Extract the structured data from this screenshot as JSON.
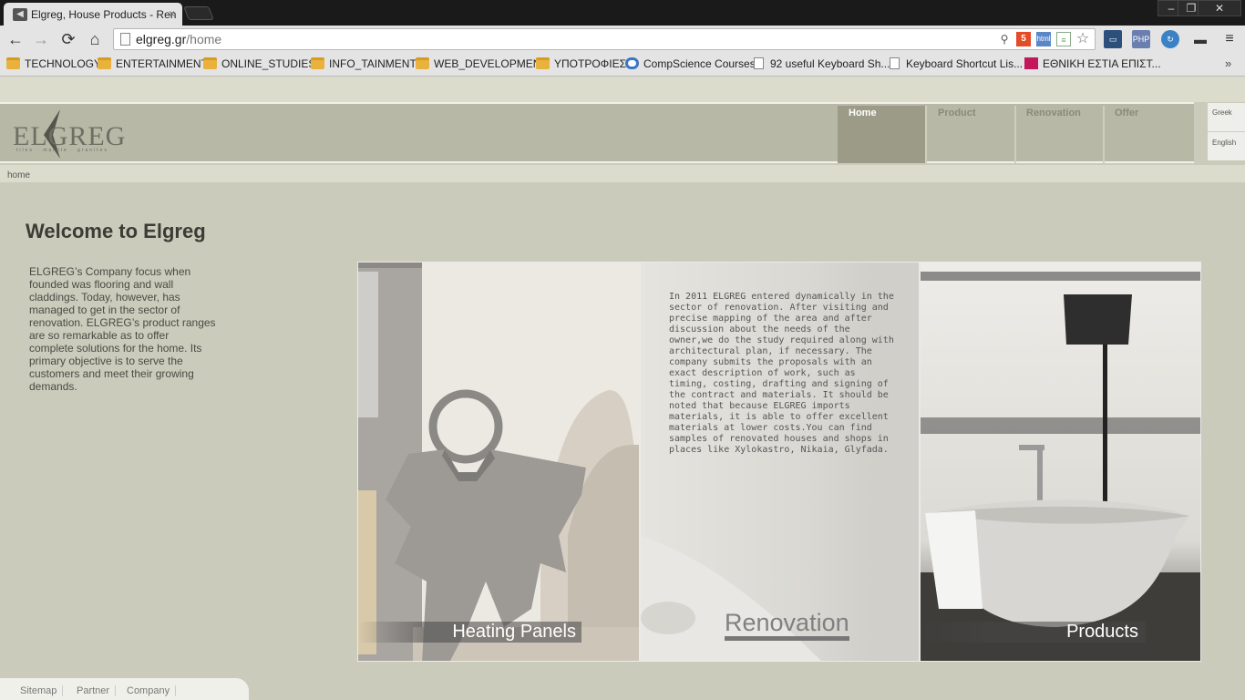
{
  "browser": {
    "tab_title": "Elgreg, House Products - Ren",
    "tab_close": "×",
    "window_controls": {
      "minimize": "–",
      "maximize": "❐",
      "close": "✕"
    },
    "nav": {
      "back": "←",
      "forward": "→",
      "reload": "⟳",
      "home": "⌂"
    },
    "url_host": "elgreg.gr",
    "url_path": "/home",
    "extensions": {
      "html5": "5",
      "ext2": "html",
      "ext3": "≡",
      "star": "☆",
      "screen": "▭",
      "php": "PHP",
      "sync": "↻",
      "bar": "▬",
      "menu": "≡"
    },
    "bookmarks": [
      {
        "label": "TECHNOLOGY",
        "icon": "folder-icon"
      },
      {
        "label": "ENTERTAINMENT",
        "icon": "folder-icon"
      },
      {
        "label": "ONLINE_STUDIES",
        "icon": "folder-icon"
      },
      {
        "label": "INFO_TAINMENT",
        "icon": "folder-icon"
      },
      {
        "label": "WEB_DEVELOPMENT",
        "icon": "folder-icon"
      },
      {
        "label": "ΥΠΟΤΡΟΦΙΕΣ",
        "icon": "folder-icon"
      },
      {
        "label": "CompScience Courses",
        "icon": "compscience-icon"
      },
      {
        "label": "92 useful Keyboard Sh...",
        "icon": "page-icon"
      },
      {
        "label": "Keyboard Shortcut Lis...",
        "icon": "page-icon"
      },
      {
        "label": "ΕΘΝΙΚΗ ΕΣΤΙΑ ΕΠΙΣΤ...",
        "icon": "site-icon"
      }
    ],
    "bookmarks_more": "»"
  },
  "header": {
    "logo_text": "ELGREG",
    "logo_tagline": "tiles · marble · granites",
    "nav": [
      {
        "label": "Home",
        "active": true
      },
      {
        "label": "Product",
        "active": false
      },
      {
        "label": "Renovation",
        "active": false
      },
      {
        "label": "Offer",
        "active": false
      }
    ],
    "languages": [
      "Greek",
      "English"
    ]
  },
  "breadcrumb": "home",
  "main": {
    "title": "Welcome to Elgreg",
    "intro": "ELGREG’s Company focus when founded was flooring and wall claddings.  Today, however, has managed to get in the sector of renovation. ELGREG’s product ranges are so remarkable as to offer complete solutions for the home. Its primary objective is to serve the customers and meet their growing demands."
  },
  "panels": {
    "heating_label": "Heating Panels",
    "renovation_title": "Renovation",
    "renovation_text": "In 2011 ELGREG entered dynamically in the sector of renovation. After visiting and precise mapping of the area and after discussion about the needs of the owner,we do the study required along with architectural plan, if necessary. The company submits the proposals with an exact description of work, such as timing, costing, drafting and signing of the contract and materials. It should be noted that because ELGREG imports materials, it is able to offer excellent materials at lower costs.You can find samples of renovated houses and shops in places like Xylokastro, Nikaia, Glyfada.",
    "products_label": "Products"
  },
  "footer": [
    "Sitemap",
    "Partner",
    "Company"
  ]
}
